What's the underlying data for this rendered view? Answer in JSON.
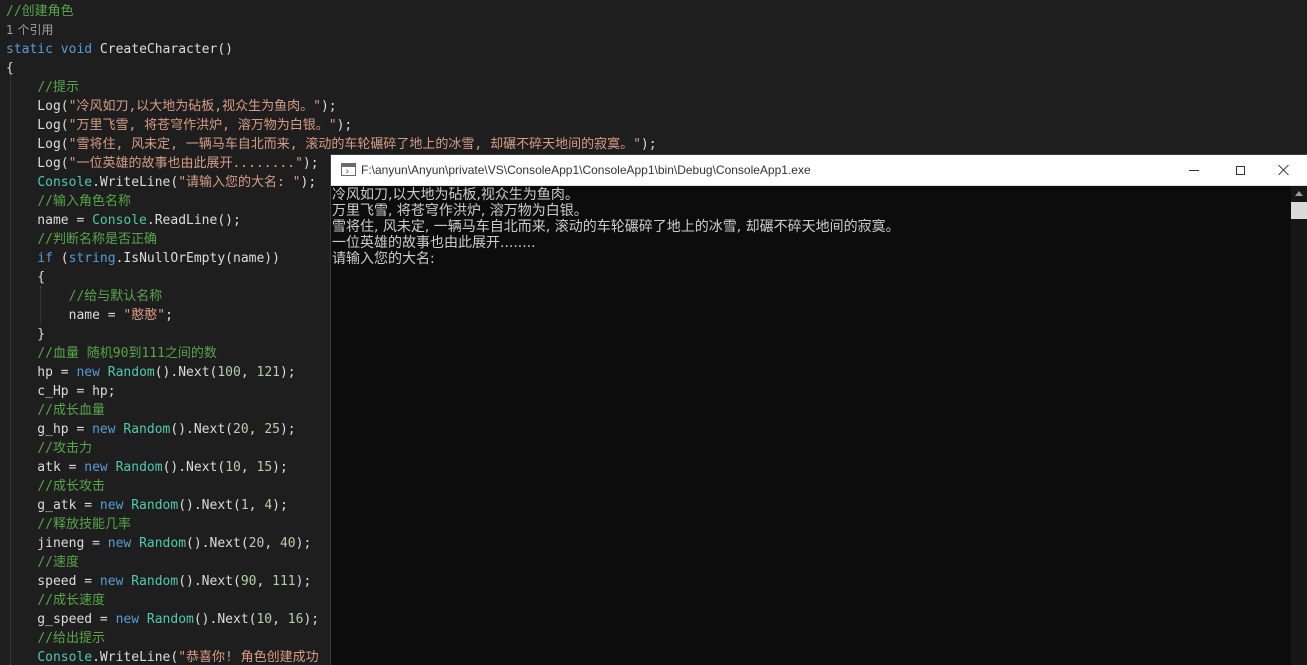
{
  "editor": {
    "lines": [
      [
        {
          "t": "//创建角色",
          "c": "com"
        }
      ],
      [
        {
          "t": "1 个引用",
          "c": "ref"
        }
      ],
      [
        {
          "t": "static",
          "c": "kw"
        },
        {
          "t": " ",
          "c": "pl"
        },
        {
          "t": "void",
          "c": "kw"
        },
        {
          "t": " CreateCharacter()",
          "c": "pl"
        }
      ],
      [
        {
          "t": "{",
          "c": "pl"
        }
      ],
      [
        {
          "t": "    ",
          "c": "pl"
        },
        {
          "t": "//提示",
          "c": "com"
        }
      ],
      [
        {
          "t": "    Log(",
          "c": "pl"
        },
        {
          "t": "\"冷风如刀,以大地为砧板,视众生为鱼肉。\"",
          "c": "str"
        },
        {
          "t": ");",
          "c": "pl"
        }
      ],
      [
        {
          "t": "    Log(",
          "c": "pl"
        },
        {
          "t": "\"万里飞雪, 将苍穹作洪炉, 溶万物为白银。\"",
          "c": "str"
        },
        {
          "t": ");",
          "c": "pl"
        }
      ],
      [
        {
          "t": "    Log(",
          "c": "pl"
        },
        {
          "t": "\"雪将住, 风未定, 一辆马车自北而来, 滚动的车轮碾碎了地上的冰雪, 却碾不碎天地间的寂寞。\"",
          "c": "str"
        },
        {
          "t": ");",
          "c": "pl"
        }
      ],
      [
        {
          "t": "    Log(",
          "c": "pl"
        },
        {
          "t": "\"一位英雄的故事也由此展开........\"",
          "c": "str"
        },
        {
          "t": ");",
          "c": "pl"
        }
      ],
      [
        {
          "t": "    ",
          "c": "pl"
        },
        {
          "t": "Console",
          "c": "typ"
        },
        {
          "t": ".WriteLine(",
          "c": "pl"
        },
        {
          "t": "\"请输入您的大名: \"",
          "c": "str"
        },
        {
          "t": ");",
          "c": "pl"
        }
      ],
      [
        {
          "t": "    ",
          "c": "pl"
        },
        {
          "t": "//输入角色名称",
          "c": "com"
        }
      ],
      [
        {
          "t": "    name = ",
          "c": "pl"
        },
        {
          "t": "Console",
          "c": "typ"
        },
        {
          "t": ".ReadLine();",
          "c": "pl"
        }
      ],
      [
        {
          "t": "    ",
          "c": "pl"
        },
        {
          "t": "//判断名称是否正确",
          "c": "com"
        }
      ],
      [
        {
          "t": "    ",
          "c": "pl"
        },
        {
          "t": "if",
          "c": "kw"
        },
        {
          "t": " (",
          "c": "pl"
        },
        {
          "t": "string",
          "c": "kw"
        },
        {
          "t": ".IsNullOrEmpty(name))",
          "c": "pl"
        }
      ],
      [
        {
          "t": "    {",
          "c": "pl"
        }
      ],
      [
        {
          "t": "        ",
          "c": "pl"
        },
        {
          "t": "//给与默认名称",
          "c": "com"
        }
      ],
      [
        {
          "t": "        name = ",
          "c": "pl"
        },
        {
          "t": "\"憨憨\"",
          "c": "str"
        },
        {
          "t": ";",
          "c": "pl"
        }
      ],
      [
        {
          "t": "    }",
          "c": "pl"
        }
      ],
      [
        {
          "t": "    ",
          "c": "pl"
        },
        {
          "t": "//血量 随机90到111之间的数",
          "c": "com"
        }
      ],
      [
        {
          "t": "    hp = ",
          "c": "pl"
        },
        {
          "t": "new",
          "c": "kw"
        },
        {
          "t": " ",
          "c": "pl"
        },
        {
          "t": "Random",
          "c": "typ"
        },
        {
          "t": "().Next(",
          "c": "pl"
        },
        {
          "t": "100",
          "c": "num"
        },
        {
          "t": ", ",
          "c": "pl"
        },
        {
          "t": "121",
          "c": "num"
        },
        {
          "t": ");",
          "c": "pl"
        }
      ],
      [
        {
          "t": "    c_Hp = hp;",
          "c": "pl"
        }
      ],
      [
        {
          "t": "    ",
          "c": "pl"
        },
        {
          "t": "//成长血量",
          "c": "com"
        }
      ],
      [
        {
          "t": "    g_hp = ",
          "c": "pl"
        },
        {
          "t": "new",
          "c": "kw"
        },
        {
          "t": " ",
          "c": "pl"
        },
        {
          "t": "Random",
          "c": "typ"
        },
        {
          "t": "().Next(",
          "c": "pl"
        },
        {
          "t": "20",
          "c": "num"
        },
        {
          "t": ", ",
          "c": "pl"
        },
        {
          "t": "25",
          "c": "num"
        },
        {
          "t": ");",
          "c": "pl"
        }
      ],
      [
        {
          "t": "    ",
          "c": "pl"
        },
        {
          "t": "//攻击力",
          "c": "com"
        }
      ],
      [
        {
          "t": "    atk = ",
          "c": "pl"
        },
        {
          "t": "new",
          "c": "kw"
        },
        {
          "t": " ",
          "c": "pl"
        },
        {
          "t": "Random",
          "c": "typ"
        },
        {
          "t": "().Next(",
          "c": "pl"
        },
        {
          "t": "10",
          "c": "num"
        },
        {
          "t": ", ",
          "c": "pl"
        },
        {
          "t": "15",
          "c": "num"
        },
        {
          "t": ");",
          "c": "pl"
        }
      ],
      [
        {
          "t": "    ",
          "c": "pl"
        },
        {
          "t": "//成长攻击",
          "c": "com"
        }
      ],
      [
        {
          "t": "    g_atk = ",
          "c": "pl"
        },
        {
          "t": "new",
          "c": "kw"
        },
        {
          "t": " ",
          "c": "pl"
        },
        {
          "t": "Random",
          "c": "typ"
        },
        {
          "t": "().Next(",
          "c": "pl"
        },
        {
          "t": "1",
          "c": "num"
        },
        {
          "t": ", ",
          "c": "pl"
        },
        {
          "t": "4",
          "c": "num"
        },
        {
          "t": ");",
          "c": "pl"
        }
      ],
      [
        {
          "t": "    ",
          "c": "pl"
        },
        {
          "t": "//释放技能几率",
          "c": "com"
        }
      ],
      [
        {
          "t": "    jineng = ",
          "c": "pl"
        },
        {
          "t": "new",
          "c": "kw"
        },
        {
          "t": " ",
          "c": "pl"
        },
        {
          "t": "Random",
          "c": "typ"
        },
        {
          "t": "().Next(",
          "c": "pl"
        },
        {
          "t": "20",
          "c": "num"
        },
        {
          "t": ", ",
          "c": "pl"
        },
        {
          "t": "40",
          "c": "num"
        },
        {
          "t": ");",
          "c": "pl"
        }
      ],
      [
        {
          "t": "    ",
          "c": "pl"
        },
        {
          "t": "//速度",
          "c": "com"
        }
      ],
      [
        {
          "t": "    speed = ",
          "c": "pl"
        },
        {
          "t": "new",
          "c": "kw"
        },
        {
          "t": " ",
          "c": "pl"
        },
        {
          "t": "Random",
          "c": "typ"
        },
        {
          "t": "().Next(",
          "c": "pl"
        },
        {
          "t": "90",
          "c": "num"
        },
        {
          "t": ", ",
          "c": "pl"
        },
        {
          "t": "111",
          "c": "num"
        },
        {
          "t": ");",
          "c": "pl"
        }
      ],
      [
        {
          "t": "    ",
          "c": "pl"
        },
        {
          "t": "//成长速度",
          "c": "com"
        }
      ],
      [
        {
          "t": "    g_speed = ",
          "c": "pl"
        },
        {
          "t": "new",
          "c": "kw"
        },
        {
          "t": " ",
          "c": "pl"
        },
        {
          "t": "Random",
          "c": "typ"
        },
        {
          "t": "().Next(",
          "c": "pl"
        },
        {
          "t": "10",
          "c": "num"
        },
        {
          "t": ", ",
          "c": "pl"
        },
        {
          "t": "16",
          "c": "num"
        },
        {
          "t": ");",
          "c": "pl"
        }
      ],
      [
        {
          "t": "    ",
          "c": "pl"
        },
        {
          "t": "//给出提示",
          "c": "com"
        }
      ],
      [
        {
          "t": "    ",
          "c": "pl"
        },
        {
          "t": "Console",
          "c": "typ"
        },
        {
          "t": ".WriteLine(",
          "c": "pl"
        },
        {
          "t": "\"恭喜你! 角色创建成功",
          "c": "str"
        }
      ]
    ]
  },
  "console": {
    "title": "F:\\anyun\\Anyun\\private\\VS\\ConsoleApp1\\ConsoleApp1\\bin\\Debug\\ConsoleApp1.exe",
    "output_lines": [
      "冷风如刀,以大地为砧板,视众生为鱼肉。",
      "万里飞雪, 将苍穹作洪炉, 溶万物为白银。",
      "雪将住, 风未定, 一辆马车自北而来, 滚动的车轮碾碎了地上的冰雪, 却碾不碎天地间的寂寞。",
      "一位英雄的故事也由此展开........",
      "请输入您的大名:"
    ],
    "icons": {
      "app": "console-app-icon",
      "minimize": "minimize-icon",
      "maximize": "maximize-icon",
      "close": "close-icon",
      "scroll_up": "scroll-up-arrow-icon"
    }
  },
  "colors": {
    "editor_background": "#1e1e1e",
    "comment": "#57a64a",
    "keyword": "#569cd6",
    "type": "#4ec9b0",
    "string": "#d69d85",
    "number": "#b5cea8",
    "console_background": "#0c0c0c",
    "console_text": "#cccccc"
  }
}
